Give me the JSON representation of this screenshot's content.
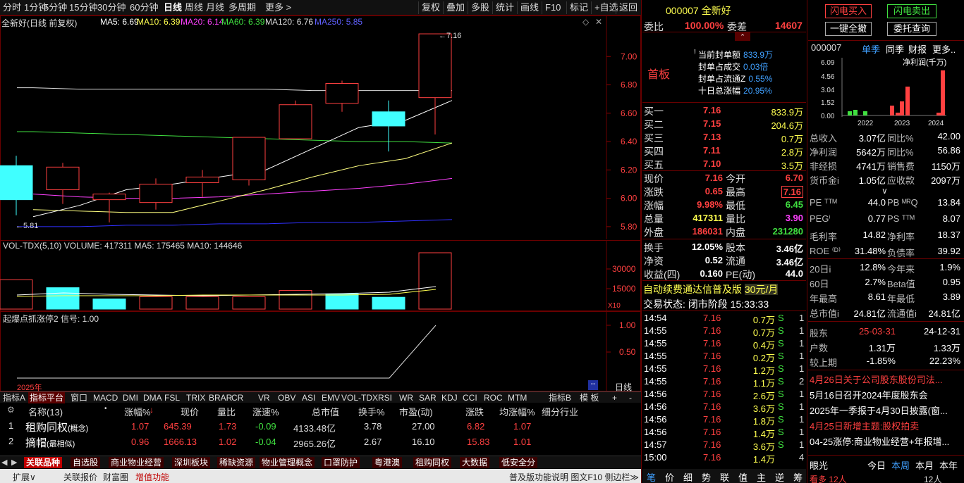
{
  "toolbar": {
    "periods": [
      "分时",
      "1分钟",
      "5分钟",
      "15分钟",
      "30分钟",
      "60分钟",
      "日线",
      "周线",
      "月线",
      "多周期",
      "更多 >"
    ],
    "active": "日线",
    "right": [
      "复权",
      "叠加",
      "多股",
      "统计",
      "画线",
      "F10",
      "标记",
      "+自选",
      "返回"
    ]
  },
  "chart": {
    "title": "全新好(日线 前复权)",
    "ma": [
      {
        "label": "MA5: 6.69",
        "color": "#ffffff"
      },
      {
        "label": "MA10: 6.39",
        "color": "#ffff50"
      },
      {
        "label": "MA20: 6.14",
        "color": "#ff40ff"
      },
      {
        "label": "MA60: 6.39",
        "color": "#40e040"
      },
      {
        "label": "MA120: 6.76",
        "color": "#dddddd"
      },
      {
        "label": "MA250: 5.85",
        "color": "#6060ff"
      }
    ],
    "price_ticks": [
      "7.00",
      "6.80",
      "6.60",
      "6.40",
      "6.20",
      "6.00",
      "5.80"
    ],
    "high_label": "7.16",
    "low_label": "5.81",
    "candles": [
      {
        "o": 6.23,
        "c": 5.99,
        "h": 6.3,
        "l": 5.88
      },
      {
        "o": 6.06,
        "c": 6.22,
        "h": 6.25,
        "l": 5.96
      },
      {
        "o": 5.99,
        "c": 6.03,
        "h": 6.04,
        "l": 5.83
      },
      {
        "o": 5.97,
        "c": 6.1,
        "h": 6.14,
        "l": 5.92
      },
      {
        "o": 6.11,
        "c": 6.15,
        "h": 6.2,
        "l": 6.01
      },
      {
        "o": 6.13,
        "c": 6.43,
        "h": 6.43,
        "l": 6.09
      },
      {
        "o": 6.42,
        "c": 6.66,
        "h": 6.69,
        "l": 6.42
      },
      {
        "o": 6.67,
        "c": 6.81,
        "h": 6.83,
        "l": 6.61
      },
      {
        "o": 6.61,
        "c": 6.51,
        "h": 6.69,
        "l": 6.33
      },
      {
        "o": 6.71,
        "c": 7.16,
        "h": 7.16,
        "l": 6.45
      }
    ],
    "ma5": [
      5.87,
      5.95,
      6.06,
      6.1,
      6.15,
      6.2,
      6.35,
      6.5,
      6.55,
      6.69
    ],
    "ma10": [
      5.92,
      5.91,
      5.9,
      5.9,
      5.98,
      6.06,
      6.15,
      6.23,
      6.28,
      6.39
    ],
    "ma20": [
      6.03,
      6.01,
      6.0,
      6.0,
      6.01,
      6.03,
      6.05,
      6.07,
      6.1,
      6.14
    ],
    "ma60": [
      6.47,
      6.46,
      6.45,
      6.44,
      6.43,
      6.42,
      6.41,
      6.4,
      6.4,
      6.39
    ],
    "ma120": [
      6.78,
      6.77,
      6.77,
      6.77,
      6.77,
      6.77,
      6.76,
      6.76,
      6.76,
      6.76
    ],
    "ma250": [
      5.8,
      5.8,
      5.81,
      5.81,
      5.82,
      5.82,
      5.83,
      5.83,
      5.84,
      5.85
    ]
  },
  "volume": {
    "title": "VOL-TDX(5,10)",
    "vals": "VOLUME: 417311  MA5: 175465  MA10: 144646",
    "ticks": [
      "30000",
      "15000"
    ],
    "unit": "X10",
    "bars": [
      1,
      0,
      0,
      1,
      1,
      1,
      1,
      0,
      0,
      1
    ],
    "heights": [
      0.52,
      0.38,
      0.18,
      0.22,
      0.22,
      0.22,
      0.33,
      0.27,
      0.21,
      1.0
    ]
  },
  "signal": {
    "title": "起爆点抓涨停2 信号: 1.00",
    "ticks": [
      "1.00",
      "0.50"
    ],
    "year": "2025年",
    "period": "日线"
  },
  "indicator_tabs": [
    "指标A",
    "指标平台",
    "窗口",
    "MACD",
    "DMI",
    "DMA",
    "FSL",
    "TRIX",
    "BRAR",
    "CR",
    "VR",
    "OBV",
    "ASI",
    "EMV",
    "VOL-TDX",
    "RSI",
    "WR",
    "SAR",
    "KDJ",
    "CCI",
    "ROC",
    "MTM",
    "指标B",
    "模 板",
    "+",
    "-"
  ],
  "table": {
    "headers": [
      "名称(13)",
      "涨幅%",
      "现价",
      "量比",
      "涨速%",
      "总市值",
      "换手%",
      "市盈(动)",
      "涨跌",
      "均涨幅%",
      "细分行业"
    ],
    "rows": [
      {
        "idx": "1",
        "name": "租购同权",
        "tag": "(概念)",
        "chg": "1.07",
        "price": "645.39",
        "vr": "1.73",
        "spd": "-0.09",
        "cap": "4133.48亿",
        "turn": "3.78",
        "pe": "27.00",
        "diff": "6.82",
        "avg": "1.07"
      },
      {
        "idx": "2",
        "name": "摘帽",
        "tag": "(最相似)",
        "chg": "0.96",
        "price": "1666.13",
        "vr": "1.02",
        "spd": "-0.04",
        "cap": "2965.26亿",
        "turn": "2.67",
        "pe": "16.10",
        "diff": "15.83",
        "avg": "1.01"
      }
    ]
  },
  "bottom_tabs": [
    "关联品种",
    "自选股",
    "商业物业经营",
    "深圳板块",
    "稀缺资源",
    "物业管理概念",
    "口罩防护",
    "粤港澳",
    "租购同权",
    "大数据",
    "低安全分"
  ],
  "status_bar": [
    "扩展∨",
    "关联报价",
    "财富圈",
    "增值功能",
    "普及版功能说明 图文F10 侧边栏≫"
  ],
  "quote": {
    "code": "000007",
    "name": "全新好",
    "weibi_label": "委比",
    "weibi": "100.00%",
    "weicha_label": "委差",
    "weicha": "14607",
    "shouban": "首板",
    "seal": [
      {
        "k": "当前封单额",
        "v": "833.9万"
      },
      {
        "k": "封单占成交",
        "v": "0.03倍"
      },
      {
        "k": "封单占流通Z",
        "v": "0.55%"
      },
      {
        "k": "十日总涨幅",
        "v": "20.95%"
      }
    ],
    "bids": [
      {
        "k": "买一",
        "p": "7.16",
        "v": "833.9万"
      },
      {
        "k": "买二",
        "p": "7.15",
        "v": "204.6万"
      },
      {
        "k": "买三",
        "p": "7.13",
        "v": "0.7万"
      },
      {
        "k": "买四",
        "p": "7.11",
        "v": "2.8万"
      },
      {
        "k": "买五",
        "p": "7.10",
        "v": "3.5万"
      }
    ],
    "stats": [
      {
        "k1": "现价",
        "v1": "7.16",
        "c1": "red",
        "k2": "今开",
        "v2": "6.70",
        "c2": "red"
      },
      {
        "k1": "涨跌",
        "v1": "0.65",
        "c1": "red",
        "k2": "最高",
        "v2": "7.16",
        "c2": "red"
      },
      {
        "k1": "涨幅",
        "v1": "9.98%",
        "c1": "red",
        "k2": "最低",
        "v2": "6.45",
        "c2": "green"
      },
      {
        "k1": "总量",
        "v1": "417311",
        "c1": "yellow",
        "k2": "量比",
        "v2": "3.90",
        "c2": "mag"
      },
      {
        "k1": "外盘",
        "v1": "186031",
        "c1": "red",
        "k2": "内盘",
        "v2": "231280",
        "c2": "green"
      }
    ],
    "stats2": [
      {
        "k1": "换手",
        "v1": "12.05%",
        "k2": "股本",
        "v2": "3.46亿"
      },
      {
        "k1": "净资",
        "v1": "0.52",
        "k2": "流通",
        "v2": "3.46亿"
      },
      {
        "k1": "收益(四)",
        "v1": "0.160",
        "k2": "PE(动)",
        "v2": "44.0"
      }
    ],
    "ad": "自动续费通达信普及版",
    "ad_price": "30元/月",
    "status": "交易状态: 闭市阶段 15:33:33",
    "ticks": [
      {
        "t": "14:54",
        "p": "7.16",
        "v": "0.7万",
        "s": "S",
        "n": "1"
      },
      {
        "t": "14:55",
        "p": "7.16",
        "v": "0.7万",
        "s": "S",
        "n": "1"
      },
      {
        "t": "14:55",
        "p": "7.16",
        "v": "0.4万",
        "s": "S",
        "n": "1"
      },
      {
        "t": "14:55",
        "p": "7.16",
        "v": "0.2万",
        "s": "S",
        "n": "1"
      },
      {
        "t": "14:55",
        "p": "7.16",
        "v": "1.2万",
        "s": "S",
        "n": "1"
      },
      {
        "t": "14:55",
        "p": "7.16",
        "v": "1.1万",
        "s": "S",
        "n": "2"
      },
      {
        "t": "14:56",
        "p": "7.16",
        "v": "2.6万",
        "s": "S",
        "n": "1"
      },
      {
        "t": "14:56",
        "p": "7.16",
        "v": "3.6万",
        "s": "S",
        "n": "1"
      },
      {
        "t": "14:56",
        "p": "7.16",
        "v": "1.8万",
        "s": "S",
        "n": "1"
      },
      {
        "t": "14:56",
        "p": "7.16",
        "v": "1.4万",
        "s": "S",
        "n": "1"
      },
      {
        "t": "14:57",
        "p": "7.16",
        "v": "3.6万",
        "s": "S",
        "n": "1"
      },
      {
        "t": "15:00",
        "p": "7.16",
        "v": "1.4万",
        "s": "",
        "n": "4"
      }
    ],
    "bottom_tabs": [
      "笔",
      "价",
      "细",
      "势",
      "联",
      "值",
      "主",
      "逆",
      "筹"
    ]
  },
  "side": {
    "btn_buy": "闪电买入",
    "btn_sell": "闪电卖出",
    "btn_cancel": "一键全撤",
    "btn_query": "委托查询",
    "code": "000007",
    "tabs": [
      "单季",
      "同季",
      "财报",
      "更多.."
    ],
    "chart_ticks": [
      "6.09",
      "4.56",
      "3.04",
      "1.52",
      "0.00"
    ],
    "chart_title": "净利润(千万)",
    "years": [
      "2022",
      "2023",
      "2024"
    ],
    "fin": [
      {
        "k1": "总收入",
        "v1": "3.07亿",
        "k2": "同比%",
        "v2": "42.00"
      },
      {
        "k1": "净利润",
        "v1": "5642万",
        "k2": "同比%",
        "v2": "56.86"
      },
      {
        "k1": "非经损",
        "v1": "4741万",
        "k2": "销售费",
        "v2": "1150万"
      },
      {
        "k1": "货币金i",
        "v1": "1.05亿",
        "k2": "应收款",
        "v2": "2097万"
      }
    ],
    "val": [
      {
        "k1": "PE ᵀᵀᴹ",
        "v1": "44.0",
        "k2": "PB ᴹᴿQ",
        "v2": "13.84"
      },
      {
        "k1": "PEGⁱ",
        "v1": "0.77",
        "k2": "PS ᵀᵀᴹ",
        "v2": "8.07"
      },
      {
        "k1": "毛利率",
        "v1": "14.82",
        "k2": "净利率",
        "v2": "18.37"
      },
      {
        "k1": "ROE ⁽ᴰ⁾",
        "v1": "31.48%",
        "k2": "负债率",
        "v2": "39.92"
      }
    ],
    "perf": [
      {
        "k1": "20日i",
        "v1": "12.8%",
        "k2": "今年来",
        "v2": "1.9%"
      },
      {
        "k1": "60日",
        "v1": "2.7%",
        "k2": "Beta值",
        "v2": "0.95"
      },
      {
        "k1": "年最高",
        "v1": "8.61",
        "k2": "年最低",
        "v2": "3.89"
      },
      {
        "k1": "总市值i",
        "v1": "24.81亿",
        "k2": "流通值i",
        "v2": "24.81亿"
      }
    ],
    "holders": [
      {
        "k": "股东",
        "v1": "25-03-31",
        "v2": "24-12-31"
      },
      {
        "k": "户数",
        "v1": "1.31万",
        "v2": "1.33万"
      },
      {
        "k": "较上期",
        "v1": "-1.85%",
        "v2": "22.23%"
      }
    ],
    "news": [
      {
        "text": "4月26日关于公司股东股份司法...",
        "color": "#ff4040"
      },
      {
        "text": "5月16日召开2024年度股东会",
        "color": "#ffffff"
      },
      {
        "text": "2025年一季报于4月30日披露(窗...",
        "color": "#ffffff"
      },
      {
        "text": "4月25日新增主题:股权拍卖",
        "color": "#ff4040"
      },
      {
        "text": "04-25涨停:商业物业经营+年报增...",
        "color": "#ffffff"
      }
    ],
    "eye": "眼光",
    "range_tabs": [
      "今日",
      "本周",
      "本月",
      "本年"
    ],
    "bottom_l": "看多 12人",
    "bottom_r": "12人"
  }
}
